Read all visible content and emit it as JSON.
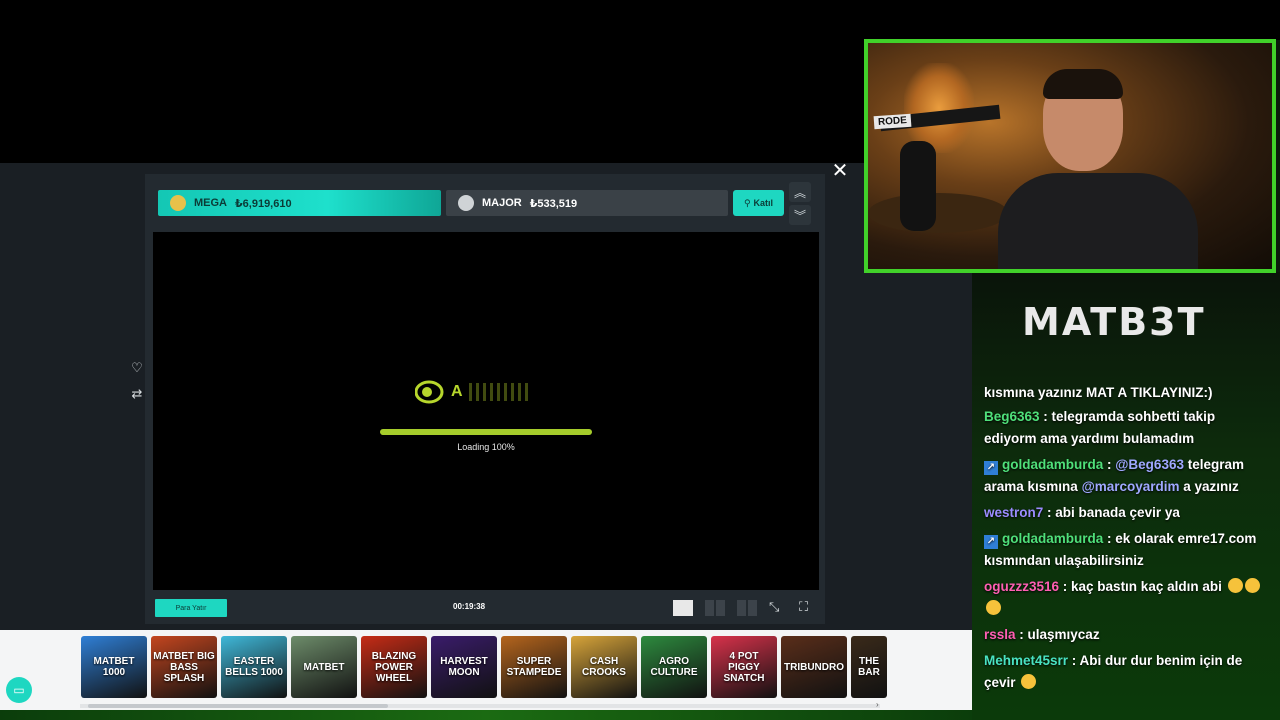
{
  "jackpots": {
    "mega": {
      "name": "MEGA",
      "value": "₺6,919,610"
    },
    "major": {
      "name": "MAJOR",
      "value": "₺533,519"
    },
    "join_label": "Katıl"
  },
  "game": {
    "logo_letter": "A",
    "loading_progress": 1.0,
    "loading_text": "Loading 100%",
    "deposit_label": "Para Yatır",
    "timer": "00:19:38"
  },
  "strip": {
    "tiles": [
      {
        "label": "MATBET 1000",
        "color": "#2f7fd6"
      },
      {
        "label": "MATBET BIG BASS SPLASH",
        "color": "#c4461f"
      },
      {
        "label": "EASTER BELLS 1000",
        "color": "#3fb8d9"
      },
      {
        "label": "MATBET",
        "color": "#6d8c6a"
      },
      {
        "label": "BLAZING POWER WHEEL",
        "color": "#c62c16"
      },
      {
        "label": "HARVEST MOON",
        "color": "#3a1c6b"
      },
      {
        "label": "SUPER STAMPEDE",
        "color": "#b5651d"
      },
      {
        "label": "CASH CROOKS",
        "color": "#d7a43a"
      },
      {
        "label": "AGRO CULTURE",
        "color": "#2d8a3e"
      },
      {
        "label": "4 POT PIGGY SNATCH",
        "color": "#d8324b"
      },
      {
        "label": "TRIBUNDRO",
        "color": "#5a2e1a"
      },
      {
        "label": "THE BAR",
        "color": "#3a2a1a"
      }
    ]
  },
  "stream": {
    "brand": "MATB3T",
    "mic_label": "RODE",
    "chat_cut": "kısmına yazınız MAT A TIKLAYINIZ:)",
    "messages": [
      {
        "user": "Beg6363",
        "color": "green",
        "badge": false,
        "parts": [
          {
            "t": " : telegramda sohbetti takip ediyorm ama yardımı bulamadım"
          }
        ]
      },
      {
        "user": "goldadamburda",
        "color": "green",
        "badge": true,
        "parts": [
          {
            "t": " : "
          },
          {
            "m": "@Beg6363"
          },
          {
            "t": " telegram arama kısmına "
          },
          {
            "m": "@marcoyardim"
          },
          {
            "t": " a yazınız"
          }
        ]
      },
      {
        "user": "westron7",
        "color": "purple",
        "badge": false,
        "parts": [
          {
            "t": " : abi banada çevir ya"
          }
        ]
      },
      {
        "user": "goldadamburda",
        "color": "green",
        "badge": true,
        "parts": [
          {
            "t": " : ek olarak emre17.com kısmından ulaşabilirsiniz"
          }
        ]
      },
      {
        "user": "oguzzz3516",
        "color": "pink",
        "badge": false,
        "parts": [
          {
            "t": " : kaç bastın kaç aldın abi "
          }
        ],
        "emojis": 3
      },
      {
        "user": "rssla",
        "color": "pink",
        "badge": false,
        "parts": [
          {
            "t": " : ulaşmıycaz"
          }
        ]
      },
      {
        "user": "Mehmet45srr",
        "color": "teal",
        "badge": false,
        "parts": [
          {
            "t": " : Abi dur dur benim için de çevir "
          }
        ],
        "emojis": 1
      }
    ]
  },
  "colors": {
    "accent": "#1ed7c1",
    "webcam_border": "#41d12a",
    "progress": "#a5cc2b"
  }
}
